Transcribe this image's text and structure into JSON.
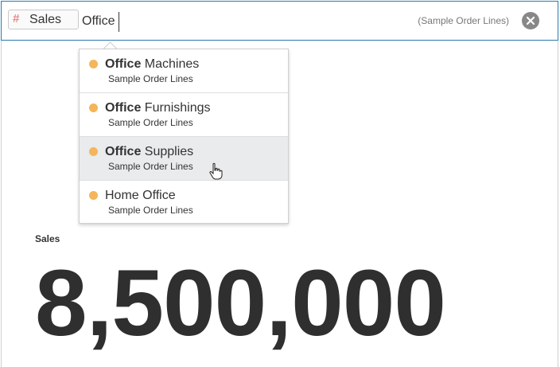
{
  "search": {
    "token_label": "Sales",
    "query": "Office",
    "source_hint": "(Sample Order Lines)"
  },
  "suggestions": [
    {
      "bold": "Office",
      "rest": " Machines",
      "source": "Sample Order Lines"
    },
    {
      "bold": "Office",
      "rest": " Furnishings",
      "source": "Sample Order Lines"
    },
    {
      "bold": "Office",
      "rest": " Supplies",
      "source": "Sample Order Lines",
      "hovered": true
    },
    {
      "bold": "",
      "rest": "Home Office",
      "source": "Sample Order Lines"
    }
  ],
  "kpi": {
    "label": "Sales",
    "value": "8,500,000"
  },
  "colors": {
    "accent": "#2a7ab0",
    "dot": "#f5b55a",
    "hover": "#e9ebed",
    "token_hash": "#e88a8a"
  },
  "icons": [
    "hash-icon",
    "clear-icon",
    "hand-cursor-icon"
  ]
}
